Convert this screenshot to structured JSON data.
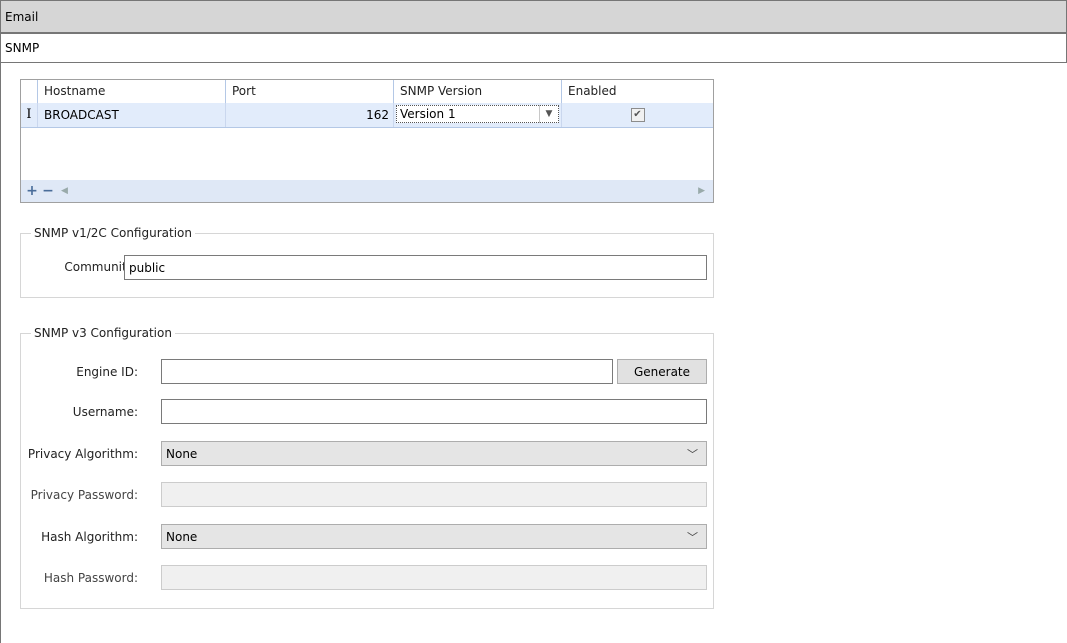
{
  "sections": {
    "email": "Email",
    "snmp": "SNMP"
  },
  "grid": {
    "columns": [
      "Hostname",
      "Port",
      "SNMP Version",
      "Enabled"
    ],
    "rows": [
      {
        "indicator": "I",
        "hostname": "BROADCAST",
        "port": "162",
        "version": "Version 1",
        "enabled": true
      }
    ],
    "footer": {
      "add": "+",
      "remove": "−"
    }
  },
  "v1": {
    "title": "SNMP v1/2C Configuration",
    "community_label": "Community:",
    "community_value": "public"
  },
  "v3": {
    "title": "SNMP v3 Configuration",
    "engine_id_label": "Engine ID:",
    "engine_id_value": "",
    "generate": "Generate",
    "username_label": "Username:",
    "username_value": "",
    "privacy_algo_label": "Privacy Algorithm:",
    "privacy_algo_value": "None",
    "privacy_password_label": "Privacy Password:",
    "hash_algo_label": "Hash Algorithm:",
    "hash_algo_value": "None",
    "hash_password_label": "Hash Password:"
  },
  "colors": {
    "header_bg": "#d6d6d6",
    "row_selected": "#e2ecfb",
    "grid_footer": "#dfe8f6"
  }
}
